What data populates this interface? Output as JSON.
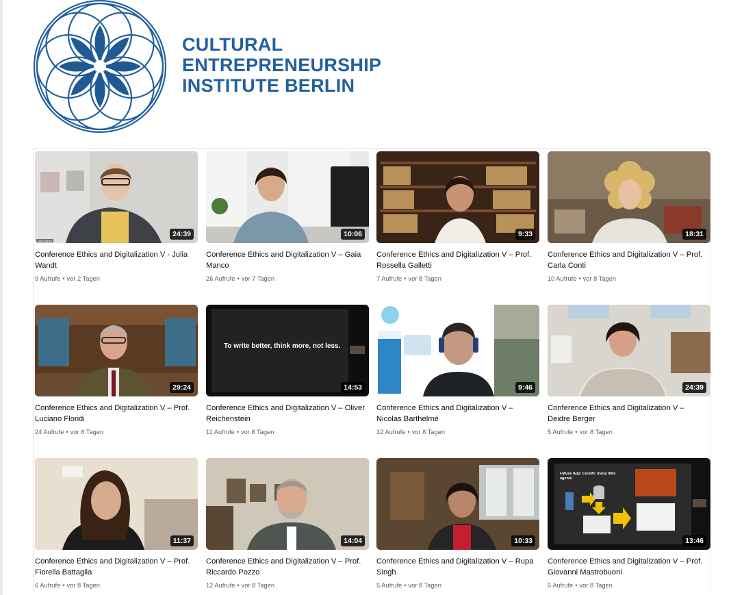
{
  "brand": {
    "line1": "CULTURAL",
    "line2": "ENTREPRENEURSHIP",
    "line3": "INSTITUTE BERLIN",
    "color": "#23609e"
  },
  "videos": [
    {
      "title": "Conference Ethics and Digitalization V - Julia Wandt",
      "views": "9 Aufrufe",
      "age": "vor 2 Tagen",
      "duration": "24:39"
    },
    {
      "title": "Conference Ethics and Digitalization V – Gaia Manco",
      "views": "26 Aufrufe",
      "age": "vor 7 Tagen",
      "duration": "10:06"
    },
    {
      "title": "Conference Ethics and Digitalization V – Prof. Rossella Galletti",
      "views": "7 Aufrufe",
      "age": "vor 8 Tagen",
      "duration": "9:33"
    },
    {
      "title": "Conference Ethics and Digitalization V – Prof. Carla Conti",
      "views": "10 Aufrufe",
      "age": "vor 8 Tagen",
      "duration": "18:31"
    },
    {
      "title": "Conference Ethics and Digitalization V – Prof. Luciano Floridi",
      "views": "24 Aufrufe",
      "age": "vor 8 Tagen",
      "duration": "29:24"
    },
    {
      "title": "Conference Ethics and Digitalization V – Oliver Reichenstein",
      "views": "11 Aufrufe",
      "age": "vor 8 Tagen",
      "duration": "14:53",
      "overlay": "To write better, think more, not less."
    },
    {
      "title": "Conference Ethics and Digitalization V – Nicolas Barthelmé",
      "views": "12 Aufrufe",
      "age": "vor 8 Tagen",
      "duration": "9:46"
    },
    {
      "title": "Conference Ethics and Digitalization V – Deidre Berger",
      "views": "5 Aufrufe",
      "age": "vor 8 Tagen",
      "duration": "24:39"
    },
    {
      "title": "Conference Ethics and Digitalization V – Prof. Fiorella Battaglia",
      "views": "6 Aufrufe",
      "age": "vor 8 Tagen",
      "duration": "11:37"
    },
    {
      "title": "Conference Ethics and Digitalization V – Prof. Riccardo Pozzo",
      "views": "12 Aufrufe",
      "age": "vor 8 Tagen",
      "duration": "14:04"
    },
    {
      "title": "Conference Ethics and Digitalization V – Rupa Singh",
      "views": "5 Aufrufe",
      "age": "vor 8 Tagen",
      "duration": "10:33"
    },
    {
      "title": "Conference Ethics and Digitalization V – Prof. Giovanni Mastrobuoni",
      "views": "5 Aufrufe",
      "age": "vor 8 Tagen",
      "duration": "13:46",
      "slide": "I-Muse App: CoreAI: many little agents"
    }
  ],
  "meta_separator": "•"
}
